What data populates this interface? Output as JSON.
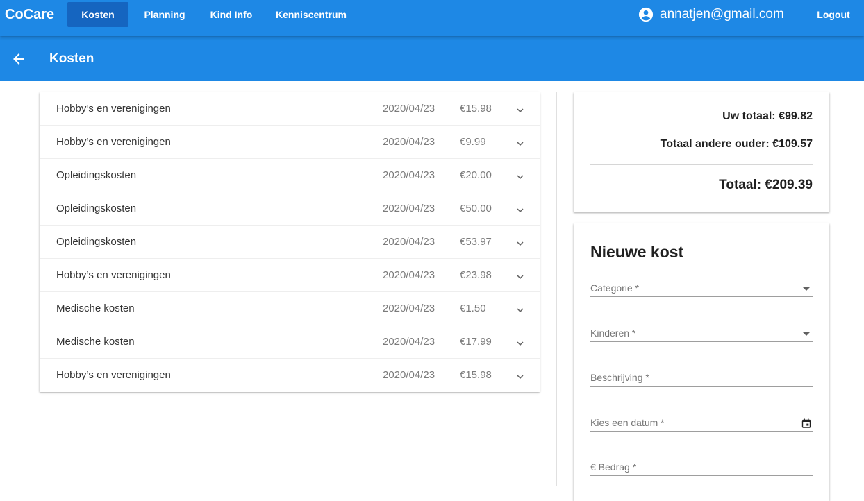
{
  "nav": {
    "brand": "CoCare",
    "links": [
      "Kosten",
      "Planning",
      "Kind Info",
      "Kenniscentrum"
    ],
    "user_email": "annatjen@gmail.com",
    "logout": "Logout",
    "accent": "#1e88e5",
    "active_bg": "#1565c0"
  },
  "subheader": {
    "title": "Kosten"
  },
  "expenses": [
    {
      "category": "Hobby’s en verenigingen",
      "date": "2020/04/23",
      "amount": "€15.98"
    },
    {
      "category": "Hobby’s en verenigingen",
      "date": "2020/04/23",
      "amount": "€9.99"
    },
    {
      "category": "Opleidingskosten",
      "date": "2020/04/23",
      "amount": "€20.00"
    },
    {
      "category": "Opleidingskosten",
      "date": "2020/04/23",
      "amount": "€50.00"
    },
    {
      "category": "Opleidingskosten",
      "date": "2020/04/23",
      "amount": "€53.97"
    },
    {
      "category": "Hobby’s en verenigingen",
      "date": "2020/04/23",
      "amount": "€23.98"
    },
    {
      "category": "Medische kosten",
      "date": "2020/04/23",
      "amount": "€1.50"
    },
    {
      "category": "Medische kosten",
      "date": "2020/04/23",
      "amount": "€17.99"
    },
    {
      "category": "Hobby’s en verenigingen",
      "date": "2020/04/23",
      "amount": "€15.98"
    }
  ],
  "totals": {
    "yours": "Uw totaal: €99.82",
    "other": "Totaal andere ouder: €109.57",
    "total": "Totaal: €209.39"
  },
  "form": {
    "title": "Nieuwe kost",
    "fields": {
      "category": {
        "label": "Categorie *",
        "icon": "dropdown-arrow-icon"
      },
      "children": {
        "label": "Kinderen *",
        "icon": "dropdown-arrow-icon"
      },
      "description": {
        "label": "Beschrijving *"
      },
      "date": {
        "label": "Kies een datum *",
        "icon": "calendar-icon"
      },
      "amount": {
        "label": "€ Bedrag *"
      }
    }
  }
}
